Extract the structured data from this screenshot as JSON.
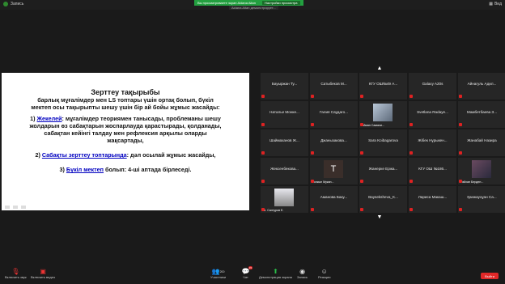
{
  "topbar": {
    "recording_label": "Запись",
    "exit_view_label": "Вид",
    "share_banner": "Вы просматриваете экран Aidana Aitan",
    "share_options": "Настройки просмотра",
    "share_sub": "Aidana Aitan демонстрирует..."
  },
  "slide": {
    "title": "Зерттеу тақырыбы",
    "intro": [
      "барлық мұғалімдер мен LS топтары үшін ортақ болып, бүкіл",
      "мектеп осы тақырыпты шешу үшін бір ай бойы жұмыс жасайды:"
    ],
    "item1_prefix": "1) ",
    "item1_link": "Жекелей",
    "item1_rest": ": мұғалімдер теориямен танысады, проблеманы шешу",
    "item1_lines": [
      "жолдарын өз сабақтарын жоспарлауда қарастырады, қолданады,",
      "сабақтан кейінгі талдау мен рефлексия арқылы оларды",
      "жақсартады,"
    ],
    "item2_prefix": "2) ",
    "item2_link": "Сабақты зерттеу топтарында",
    "item2_rest": ": дәл осылай жұмыс жасайды,",
    "item3_prefix": "3) ",
    "item3_link": "Бүкіл мектеп",
    "item3_rest": " болып: 4-ші аптада бірлеседі."
  },
  "participants": [
    {
      "name": "Бауыржан Ту..."
    },
    {
      "name": "Сатыбеков М..."
    },
    {
      "name": "КГУ ОШ№49 А..."
    },
    {
      "name": "Galaxy A20s"
    },
    {
      "name": "Айнагуль Адил..."
    },
    {
      "name": "Наталье Монке..."
    },
    {
      "name": "Галия Саудаго..."
    },
    {
      "name": "",
      "small": "Айман Самали...",
      "avatar": "photo"
    },
    {
      "name": "Svetlana Radaye..."
    },
    {
      "name": "Мамбетбаева З..."
    },
    {
      "name": "Шаймаханов Ж..."
    },
    {
      "name": "Джанызакова..."
    },
    {
      "name": "Sara Koibagarova"
    },
    {
      "name": "Жібек Нұрыкен..."
    },
    {
      "name": "Жанабай Назира"
    },
    {
      "name": "Жексенбекова..."
    },
    {
      "name": "",
      "small": "Толкын Мукан...",
      "avatar": "initial",
      "initial": "T"
    },
    {
      "name": "Жанерке Ержа..."
    },
    {
      "name": "КГУ ОШ №186..."
    },
    {
      "name": "",
      "small": "Райхан Берден...",
      "avatar": "photo-dark"
    },
    {
      "name": "",
      "small": "Ш. Салгуров Е.",
      "avatar": "photo-white"
    },
    {
      "name": "Аманова Баку..."
    },
    {
      "name": "Bayseksheva_K..."
    },
    {
      "name": "Лариса Макаш..."
    },
    {
      "name": "Қанжаухұан Са..."
    }
  ],
  "toolbar": {
    "mic_label": "Включить звук",
    "video_label": "Включить видео",
    "participants_label": "Участники",
    "participants_count": "200",
    "chat_label": "Чат",
    "chat_badge": "15",
    "share_label": "Демонстрация экрана",
    "record_label": "Запись",
    "reactions_label": "Реакции",
    "exit_label": "Выйти"
  }
}
